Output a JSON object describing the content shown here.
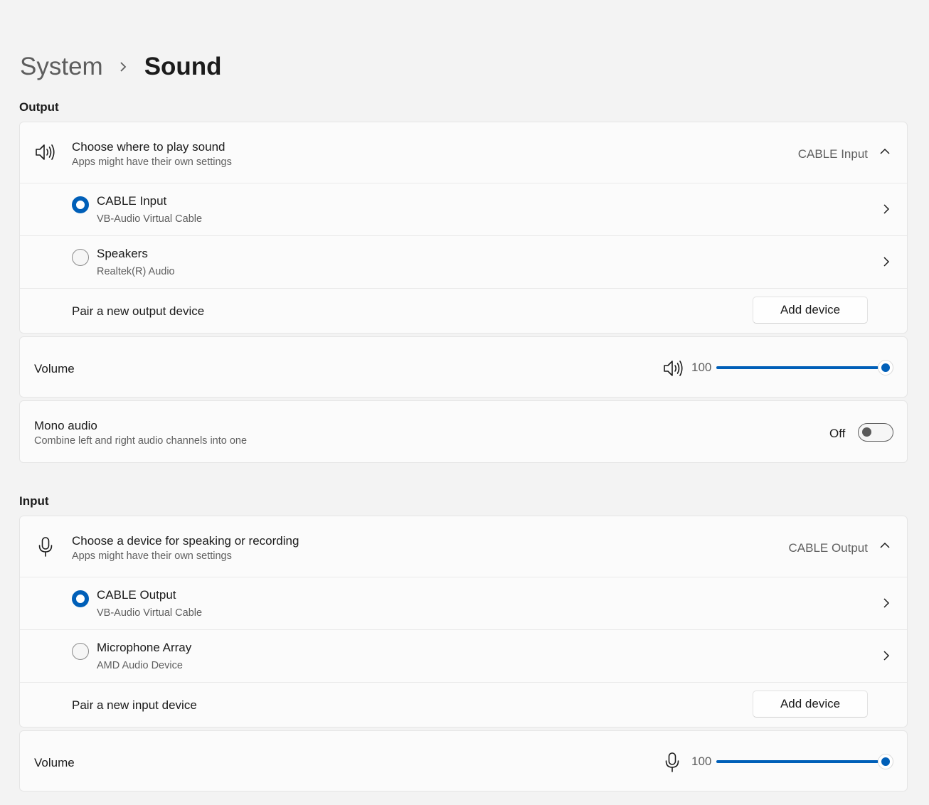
{
  "breadcrumb": {
    "parent": "System",
    "current": "Sound"
  },
  "output": {
    "section_title": "Output",
    "chooser": {
      "title": "Choose where to play sound",
      "subtitle": "Apps might have their own settings",
      "selected": "CABLE Input",
      "icon": "speaker-icon"
    },
    "devices": [
      {
        "name": "CABLE Input",
        "description": "VB-Audio Virtual Cable",
        "selected": true
      },
      {
        "name": "Speakers",
        "description": "Realtek(R) Audio",
        "selected": false
      }
    ],
    "pair": {
      "label": "Pair a new output device",
      "button": "Add device"
    },
    "volume": {
      "label": "Volume",
      "value": "100",
      "level": 1.0,
      "icon": "speaker-icon"
    },
    "mono": {
      "title": "Mono audio",
      "subtitle": "Combine left and right audio channels into one",
      "state": "Off"
    }
  },
  "input": {
    "section_title": "Input",
    "chooser": {
      "title": "Choose a device for speaking or recording",
      "subtitle": "Apps might have their own settings",
      "selected": "CABLE Output",
      "icon": "microphone-icon"
    },
    "devices": [
      {
        "name": "CABLE Output",
        "description": "VB-Audio Virtual Cable",
        "selected": true
      },
      {
        "name": "Microphone Array",
        "description": "AMD Audio Device",
        "selected": false
      }
    ],
    "pair": {
      "label": "Pair a new input device",
      "button": "Add device"
    },
    "volume": {
      "label": "Volume",
      "value": "100",
      "level": 1.0,
      "icon": "microphone-icon"
    }
  },
  "colors": {
    "accent": "#005fb8",
    "background": "#f3f3f3",
    "card": "#fbfbfb"
  }
}
